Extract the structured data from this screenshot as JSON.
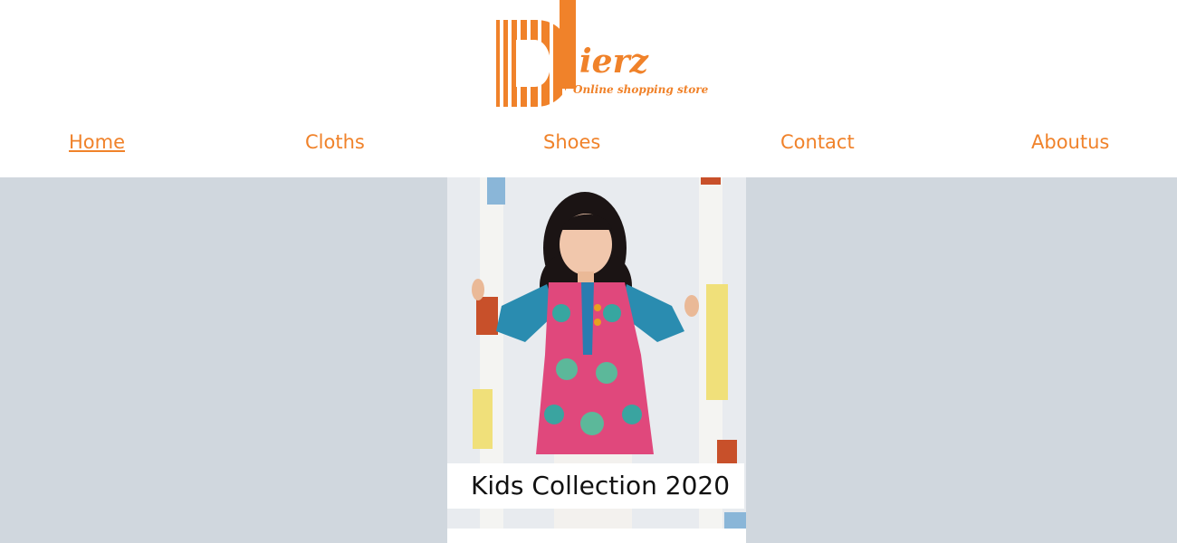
{
  "brand": {
    "name": "ierz",
    "tagline": "Online shopping store",
    "color": "#f0822a"
  },
  "nav": {
    "items": [
      {
        "label": "Home",
        "active": true
      },
      {
        "label": "Cloths",
        "active": false
      },
      {
        "label": "Shoes",
        "active": false
      },
      {
        "label": "Contact",
        "active": false
      },
      {
        "label": "Aboutus",
        "active": false
      }
    ]
  },
  "banner": {
    "caption": "Kids Collection 2020",
    "background": "#d0d7de"
  }
}
